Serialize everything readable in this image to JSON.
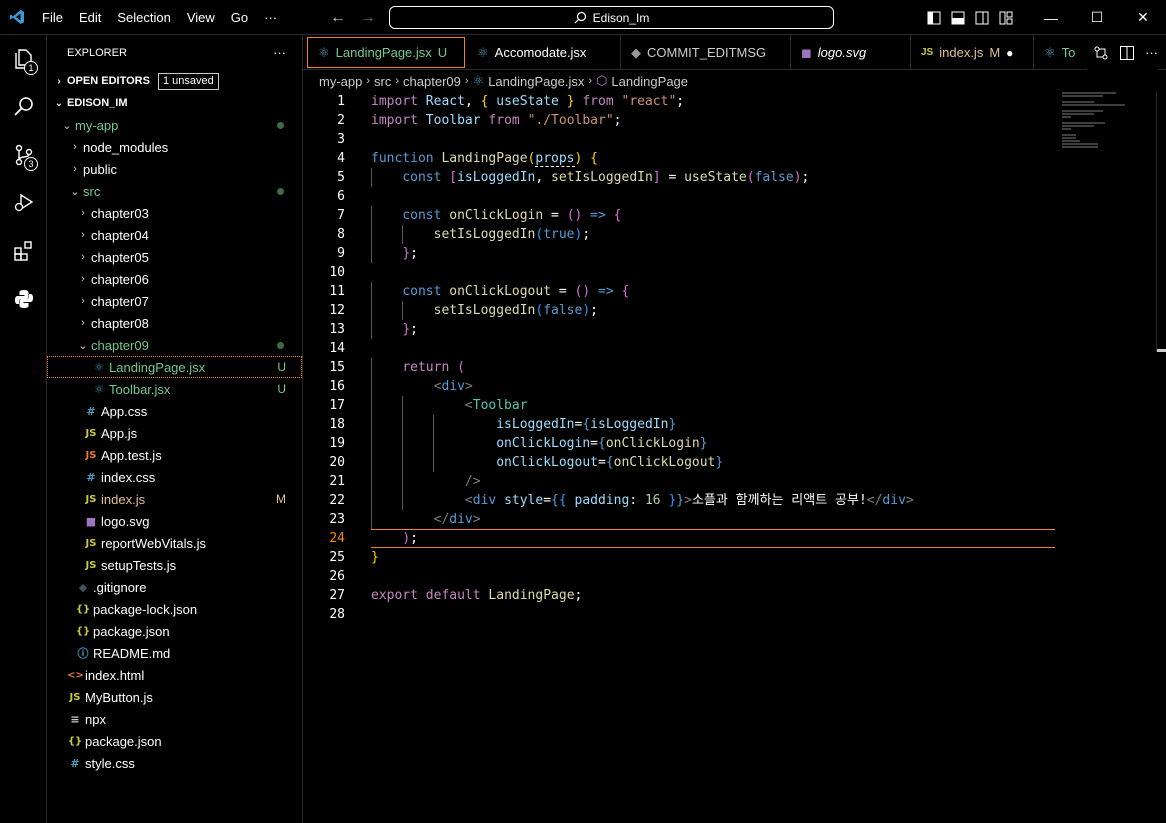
{
  "menu": [
    "File",
    "Edit",
    "Selection",
    "View",
    "Go",
    "···"
  ],
  "search": {
    "label": "Edison_Im"
  },
  "window": {
    "minimize": "—",
    "maximize": "☐",
    "close": "✕"
  },
  "activity": {
    "explorer_badge": "1",
    "scm_badge": "3"
  },
  "sidebar": {
    "title": "EXPLORER",
    "more": "···",
    "open_editors": "OPEN EDITORS",
    "unsaved": "1 unsaved",
    "workspace": "EDISON_IM",
    "tree": [
      {
        "label": "my-app",
        "type": "folder-open",
        "depth": 1,
        "color": "green",
        "dot": true
      },
      {
        "label": "node_modules",
        "type": "folder",
        "depth": 2
      },
      {
        "label": "public",
        "type": "folder",
        "depth": 2
      },
      {
        "label": "src",
        "type": "folder-open",
        "depth": 2,
        "color": "green",
        "dot": true
      },
      {
        "label": "chapter03",
        "type": "folder",
        "depth": 3
      },
      {
        "label": "chapter04",
        "type": "folder",
        "depth": 3
      },
      {
        "label": "chapter05",
        "type": "folder",
        "depth": 3
      },
      {
        "label": "chapter06",
        "type": "folder",
        "depth": 3
      },
      {
        "label": "chapter07",
        "type": "folder",
        "depth": 3
      },
      {
        "label": "chapter08",
        "type": "folder",
        "depth": 3
      },
      {
        "label": "chapter09",
        "type": "folder-open",
        "depth": 3,
        "color": "green",
        "dot": true
      },
      {
        "label": "LandingPage.jsx",
        "type": "react",
        "depth": 4,
        "color": "green",
        "status": "U",
        "selected": true
      },
      {
        "label": "Toolbar.jsx",
        "type": "react",
        "depth": 4,
        "color": "green",
        "status": "U"
      },
      {
        "label": "App.css",
        "type": "css",
        "depth": 3
      },
      {
        "label": "App.js",
        "type": "js",
        "depth": 3
      },
      {
        "label": "App.test.js",
        "type": "test",
        "depth": 3
      },
      {
        "label": "index.css",
        "type": "css",
        "depth": 3
      },
      {
        "label": "index.js",
        "type": "js",
        "depth": 3,
        "color": "modified",
        "status": "M"
      },
      {
        "label": "logo.svg",
        "type": "svg",
        "depth": 3
      },
      {
        "label": "reportWebVitals.js",
        "type": "js",
        "depth": 3
      },
      {
        "label": "setupTests.js",
        "type": "js",
        "depth": 3
      },
      {
        "label": ".gitignore",
        "type": "git",
        "depth": 2
      },
      {
        "label": "package-lock.json",
        "type": "json",
        "depth": 2
      },
      {
        "label": "package.json",
        "type": "json",
        "depth": 2
      },
      {
        "label": "README.md",
        "type": "info",
        "depth": 2
      },
      {
        "label": "index.html",
        "type": "html",
        "depth": 1
      },
      {
        "label": "MyButton.js",
        "type": "js",
        "depth": 1
      },
      {
        "label": "npx",
        "type": "text",
        "depth": 1
      },
      {
        "label": "package.json",
        "type": "json",
        "depth": 1
      },
      {
        "label": "style.css",
        "type": "css",
        "depth": 1
      }
    ]
  },
  "tabs": [
    {
      "label": "LandingPage.jsx",
      "icon": "react-icon",
      "status": "U",
      "active": true
    },
    {
      "label": "Accomodate.jsx",
      "icon": "react-icon"
    },
    {
      "label": "COMMIT_EDITMSG",
      "icon": "git-icon"
    },
    {
      "label": "logo.svg",
      "icon": "svg-icon",
      "italic": true
    },
    {
      "label": "index.js",
      "icon": "js-icon",
      "status": "M",
      "dirty": true
    },
    {
      "label": "To",
      "icon": "react-icon"
    }
  ],
  "breadcrumbs": [
    "my-app",
    "src",
    "chapter09",
    "LandingPage.jsx",
    "LandingPage"
  ],
  "editor": {
    "current_line": 24,
    "line_count": 28
  }
}
